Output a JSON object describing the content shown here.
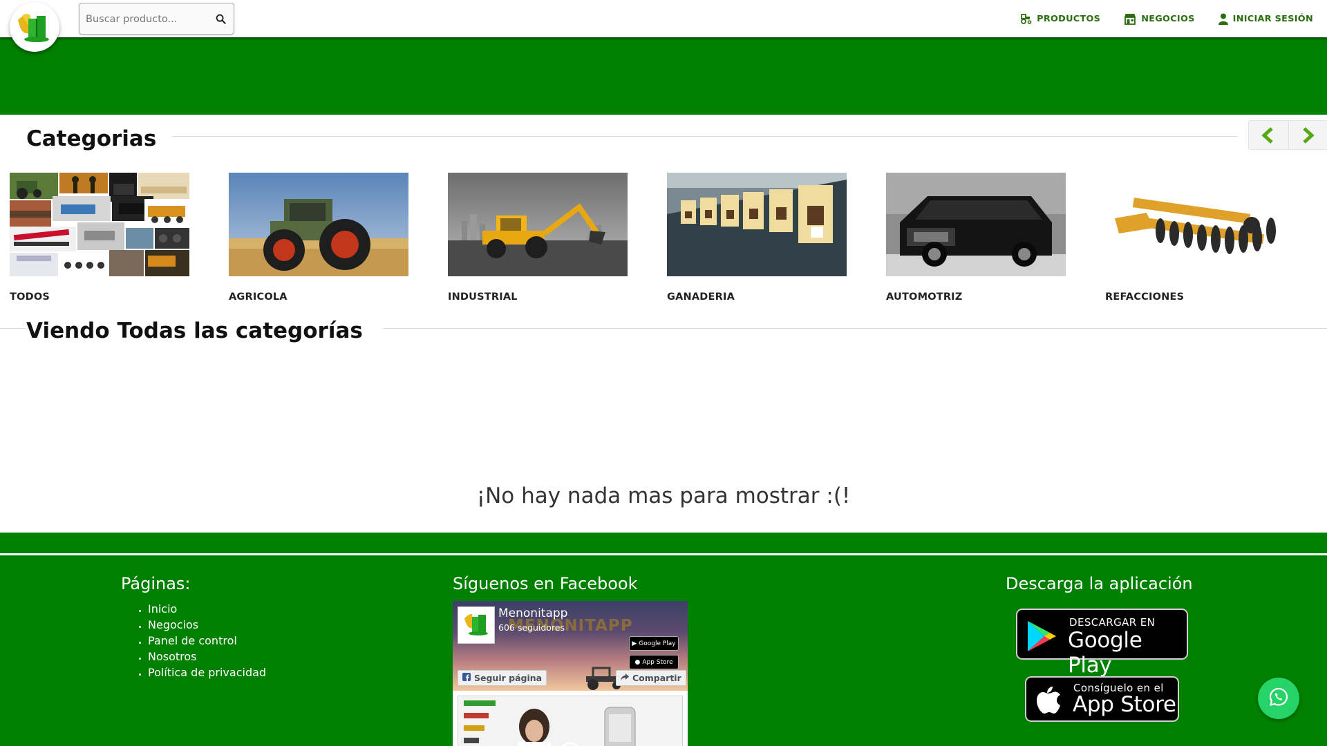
{
  "header": {
    "search_placeholder": "Buscar producto...",
    "nav": [
      {
        "label": "PRODUCTOS",
        "icon": "tractor-icon"
      },
      {
        "label": "NEGOCIOS",
        "icon": "store-icon"
      },
      {
        "label": "INICIAR SESIÓN",
        "icon": "user-icon"
      }
    ]
  },
  "categories_section": {
    "title": "Categorias",
    "items": [
      {
        "label": "TODOS"
      },
      {
        "label": "AGRICOLA"
      },
      {
        "label": "INDUSTRIAL"
      },
      {
        "label": "GANADERIA"
      },
      {
        "label": "AUTOMOTRIZ"
      },
      {
        "label": "REFACCIONES"
      }
    ]
  },
  "listing": {
    "title": "Viendo Todas las categorías",
    "empty_message": "¡No hay nada mas para mostrar :(!"
  },
  "footer": {
    "pages_title": "Páginas:",
    "pages": [
      "Inicio",
      "Negocios",
      "Panel de control",
      "Nosotros",
      "Política de privacidad"
    ],
    "facebook_title": "Síguenos en Facebook",
    "facebook": {
      "page_name": "Menonitapp",
      "followers": "606 seguidores",
      "follow_label": "Seguir página",
      "share_label": "Compartir",
      "badge_google": "Google Play",
      "badge_apple": "App Store"
    },
    "app_title": "Descarga la aplicación",
    "google_play": {
      "small": "DESCARGAR EN",
      "big": "Google Play"
    },
    "app_store": {
      "small": "Consíguelo en el",
      "big": "App Store"
    }
  },
  "colors": {
    "primary_green": "#008000",
    "nav_green": "#2b6e10",
    "whatsapp": "#25d366"
  }
}
